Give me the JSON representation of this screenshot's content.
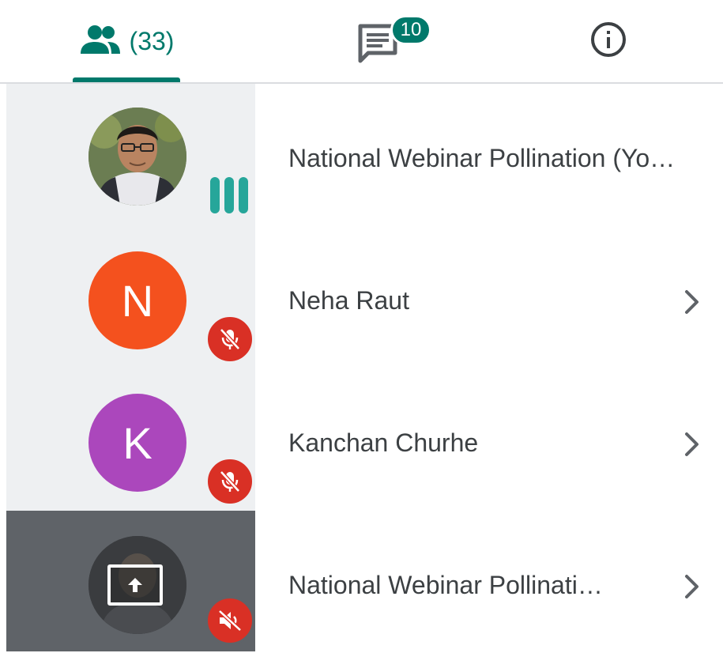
{
  "tabs": {
    "people_count": "(33)",
    "chat_badge": "10",
    "accent_color": "#00796b"
  },
  "participants": [
    {
      "name": "National Webinar Pollination (Yo…",
      "avatar": "photo",
      "status": "speaking"
    },
    {
      "name": "Neha Raut",
      "avatar_letter": "N",
      "avatar_color": "#f4511e",
      "status": "muted"
    },
    {
      "name": "Kanchan Churhe",
      "avatar_letter": "K",
      "avatar_color": "#ab47bc",
      "status": "muted"
    },
    {
      "name": "National Webinar Pollinati…",
      "avatar": "presenting",
      "status": "audio-muted"
    }
  ]
}
